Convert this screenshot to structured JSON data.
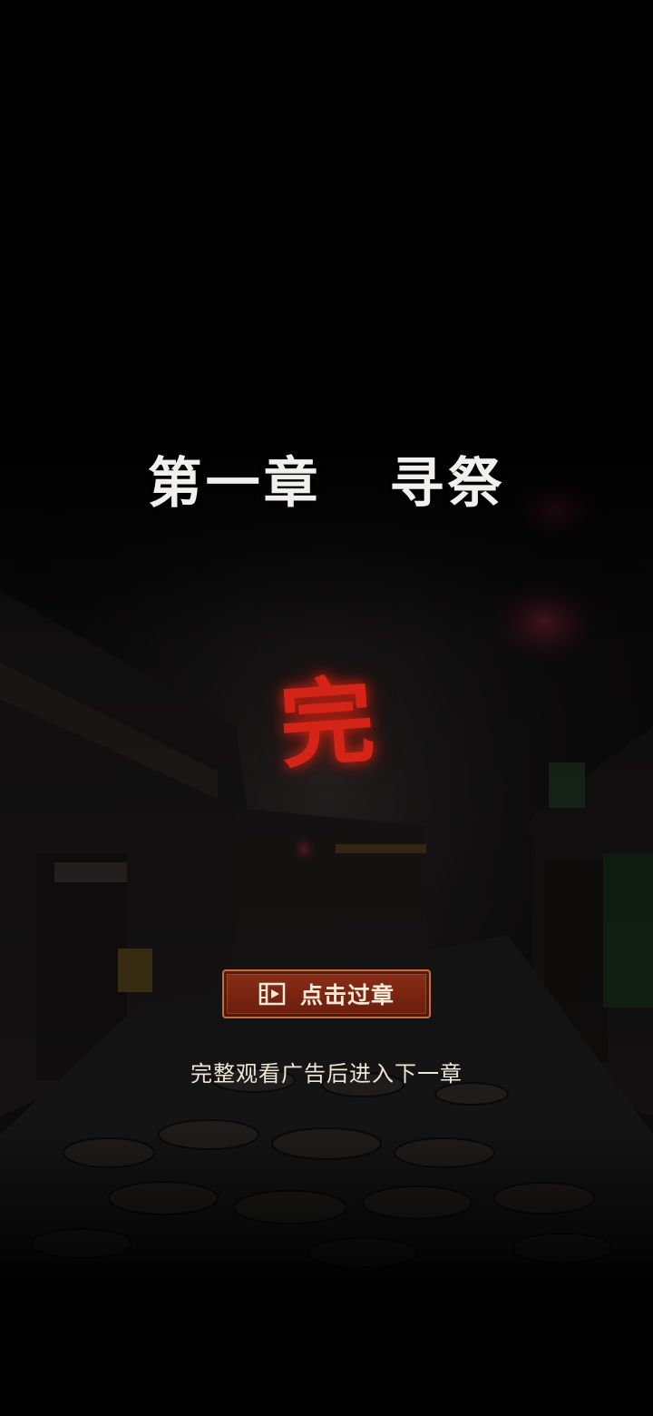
{
  "chapter": {
    "title": "第一章   寻祭",
    "complete_mark": "完"
  },
  "actions": {
    "skip_label": "点击过章",
    "skip_icon": "film-icon",
    "hint": "完整观看广告后进入下一章"
  },
  "colors": {
    "background": "#000000",
    "title_text": "#f2f0ec",
    "complete_mark": "#d42418",
    "button_fill": "#7a2512",
    "button_border": "#c96a3c"
  }
}
